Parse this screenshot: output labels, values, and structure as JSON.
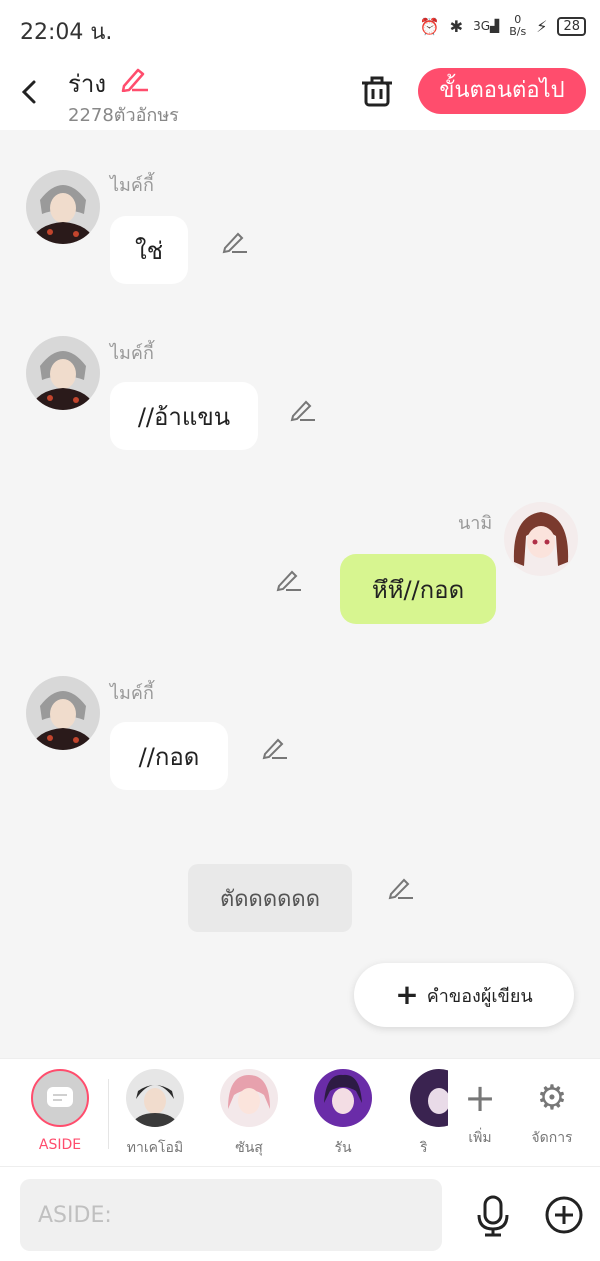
{
  "status_bar": {
    "time": "22:04 น.",
    "net_speed_top": "0",
    "net_speed_bottom": "B/s",
    "signal_label": "3G",
    "battery": "28"
  },
  "header": {
    "title": "ร่าง",
    "subtitle": "2278ตัวอักษร",
    "next_label": "ขั้นตอนต่อไป"
  },
  "messages": [
    {
      "speaker": "ไมค์กี้",
      "text": "ใช่"
    },
    {
      "speaker": "ไมค์กี้",
      "text": "//อ้าแขน"
    },
    {
      "speaker": "นามิ",
      "text": "หึหึ//กอด"
    },
    {
      "speaker": "ไมค์กี้",
      "text": "//กอด"
    },
    {
      "speaker": "",
      "text": "ตัดดดดดด"
    }
  ],
  "author_button_label": "คำของผู้เขียน",
  "characters": [
    {
      "label": "ASIDE"
    },
    {
      "label": "ทาเคโอมิ"
    },
    {
      "label": "ซันสุ"
    },
    {
      "label": "รัน"
    },
    {
      "label": "ริ"
    }
  ],
  "tools": {
    "add_label": "เพิ่ม",
    "manage_label": "จัดการ"
  },
  "input": {
    "placeholder": "ASIDE:"
  },
  "colors": {
    "accent": "#ff4d6d",
    "bubble_green": "#d7f590"
  }
}
